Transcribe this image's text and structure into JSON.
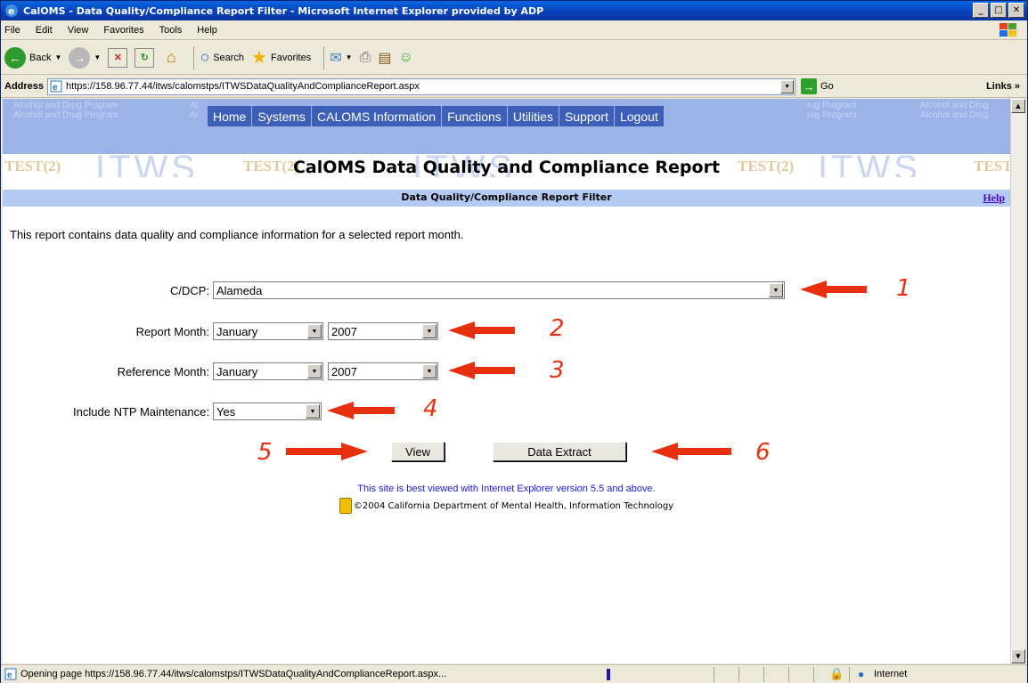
{
  "window": {
    "title": "CalOMS - Data Quality/Compliance Report Filter - Microsoft Internet Explorer provided by ADP"
  },
  "menu": {
    "items": [
      "File",
      "Edit",
      "View",
      "Favorites",
      "Tools",
      "Help"
    ]
  },
  "toolbar": {
    "back_label": "Back",
    "search_label": "Search",
    "favorites_label": "Favorites"
  },
  "address": {
    "label": "Address",
    "url": "https://158.96.77.44/itws/calomstps/ITWSDataQualityAndComplianceReport.aspx",
    "go_label": "Go",
    "links_label": "Links"
  },
  "sitenav": {
    "bg_text": "Alcohol and Drug Program",
    "bg_text_partial_a": "Al",
    "bg_text_partial_b": "rug Program",
    "bg_text_partial_c": "Alcohol and Drug",
    "items": [
      "Home",
      "Systems",
      "CALOMS Information",
      "Functions",
      "Utilities",
      "Support",
      "Logout"
    ],
    "watermark_itws": "ITWS",
    "watermark_test": "TEST(2)"
  },
  "page": {
    "title": "CalOMS Data Quality and Compliance Report",
    "subheader": "Data Quality/Compliance Report Filter",
    "help_label": "Help",
    "intro": "This report contains data quality and compliance information for a selected report month."
  },
  "form": {
    "cdcp_label": "C/DCP:",
    "cdcp_value": "Alameda",
    "report_month_label": "Report Month:",
    "report_month_value": "January",
    "report_year_value": "2007",
    "reference_month_label": "Reference Month:",
    "reference_month_value": "January",
    "reference_year_value": "2007",
    "ntp_label": "Include NTP Maintenance:",
    "ntp_value": "Yes",
    "view_label": "View",
    "extract_label": "Data Extract"
  },
  "footer": {
    "best_viewed": "This site is best viewed with Internet Explorer version 5.5 and above.",
    "copyright": "©2004 California Department of Mental Health, Information Technology"
  },
  "annotations": [
    "1",
    "2",
    "3",
    "4",
    "5",
    "6"
  ],
  "annotation_color": "#e83010",
  "status": {
    "text": "Opening page https://158.96.77.44/itws/calomstps/ITWSDataQualityAndComplianceReport.aspx...",
    "zone": "Internet"
  }
}
